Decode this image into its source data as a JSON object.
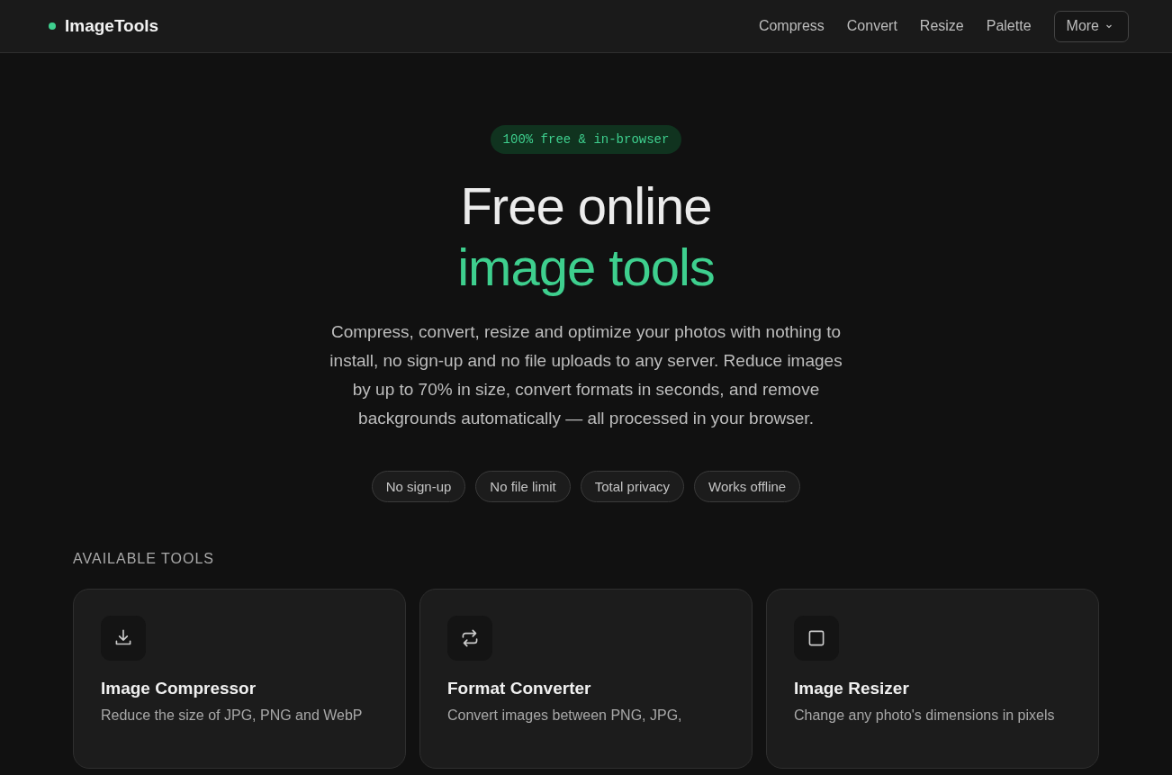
{
  "brand": {
    "name": "ImageTools"
  },
  "nav": [
    {
      "label": "Compress",
      "kind": "link"
    },
    {
      "label": "Convert",
      "kind": "link"
    },
    {
      "label": "Resize",
      "kind": "link"
    },
    {
      "label": "Palette",
      "kind": "link"
    },
    {
      "label": "More",
      "kind": "dropdown"
    }
  ],
  "hero": {
    "badge": "100% free & in-browser",
    "title_line_1": "Free online",
    "title_line_2": "image tools",
    "description": "Compress, convert, resize and optimize your photos with nothing to install, no sign-up and no file uploads to any server. Reduce images by up to 70% in size, convert formats in seconds, and remove backgrounds automatically — all processed in your browser.",
    "features": [
      "No sign-up",
      "No file limit",
      "Total privacy",
      "Works offline"
    ]
  },
  "tools": {
    "heading": "AVAILABLE TOOLS",
    "items": [
      {
        "title": "Image Compressor",
        "description": "Reduce the size of JPG, PNG and WebP"
      },
      {
        "title": "Format Converter",
        "description": "Convert images between PNG, JPG,"
      },
      {
        "title": "Image Resizer",
        "description": "Change any photo's dimensions in pixels"
      }
    ]
  }
}
